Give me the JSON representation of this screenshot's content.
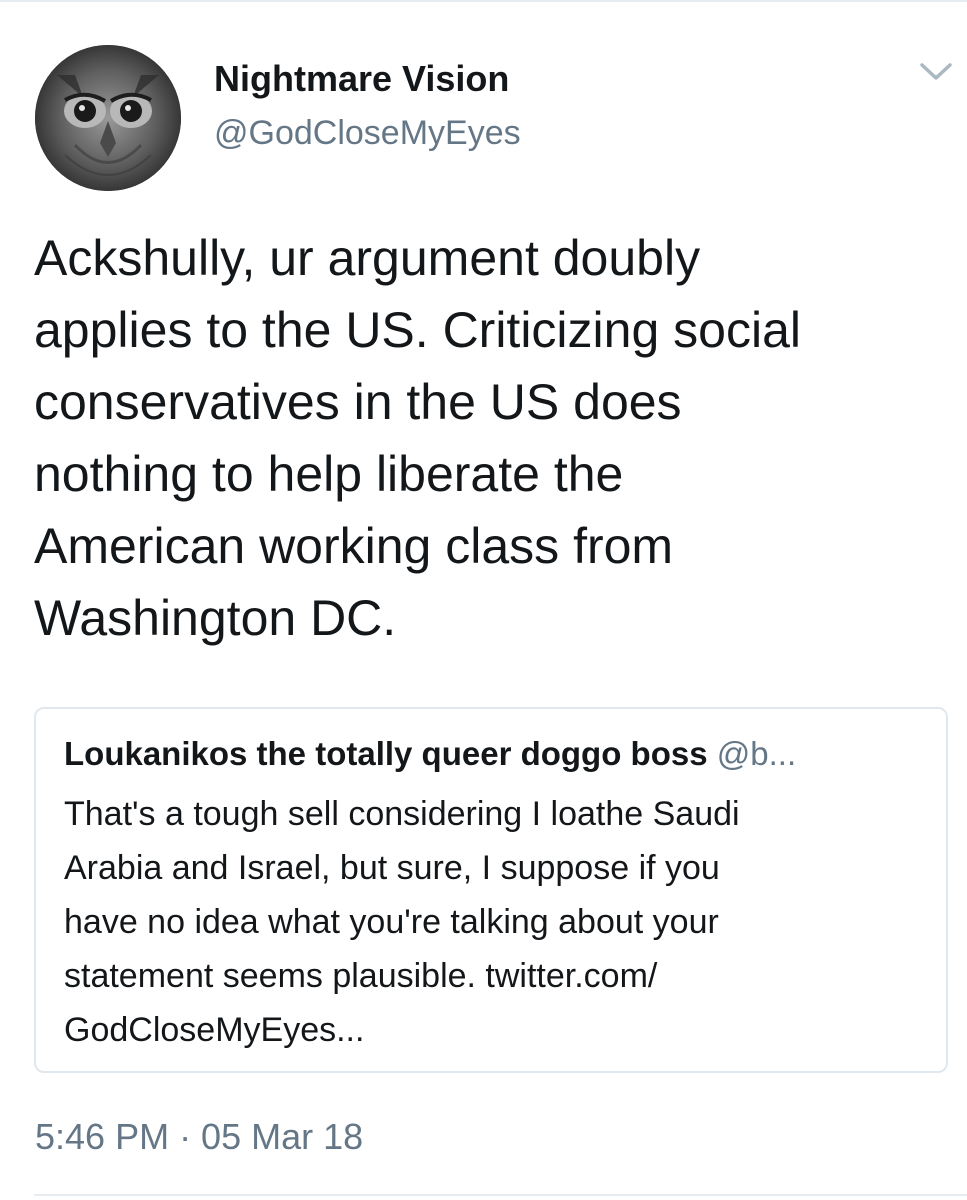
{
  "author": {
    "display_name": "Nightmare Vision",
    "handle": "@GodCloseMyEyes",
    "avatar_icon": "owl-avatar"
  },
  "menu_icon": "chevron-down-icon",
  "tweet": {
    "lines": [
      "Ackshully, ur argument doubly",
      "applies to the US. Criticizing social",
      "conservatives in the US does",
      "nothing to help liberate the",
      "American working class from",
      "Washington DC."
    ]
  },
  "quoted_tweet": {
    "display_name": "Loukanikos the totally queer doggo boss",
    "handle": "@b...",
    "lines": [
      "That's a tough sell considering I loathe Saudi",
      "Arabia and Israel, but sure, I suppose if you",
      "have no idea what you're talking about your",
      "statement seems plausible. twitter.com/",
      "GodCloseMyEyes..."
    ]
  },
  "timestamp": "5:46 PM · 05 Mar 18",
  "colors": {
    "text": "#14171a",
    "secondary": "#657786",
    "border": "#e1e8ed"
  }
}
